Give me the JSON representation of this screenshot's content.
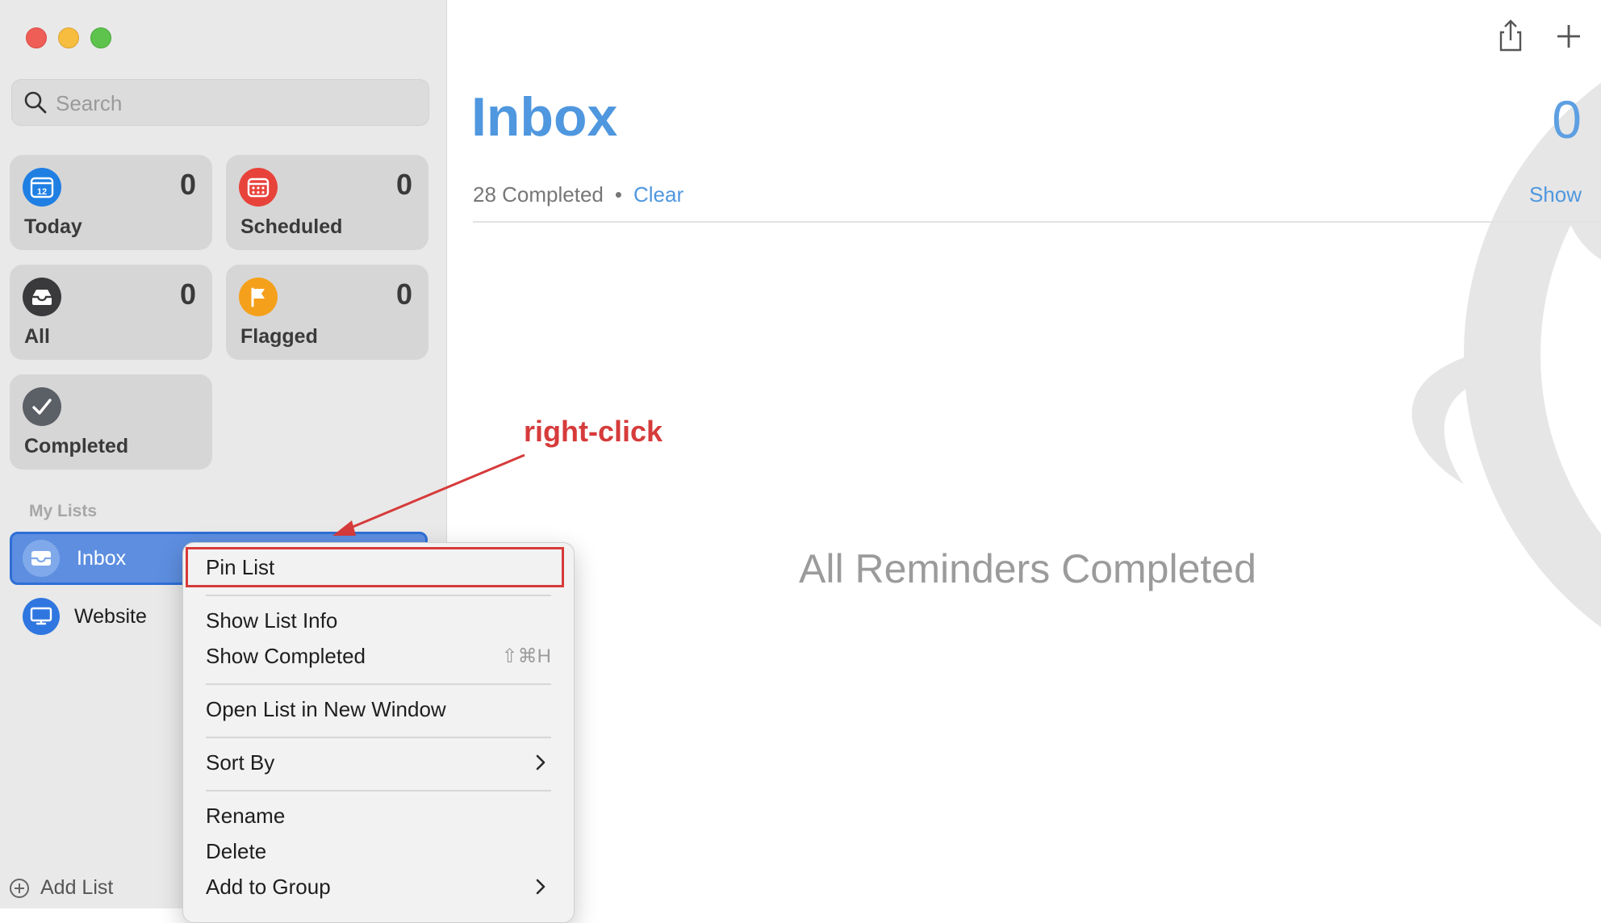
{
  "sidebar": {
    "search": {
      "placeholder": "Search",
      "icon": "search-icon"
    },
    "smart_lists": [
      {
        "label": "Today",
        "count": "0",
        "icon": "calendar-icon",
        "icon_text": "12",
        "color": "#1f7fe3"
      },
      {
        "label": "Scheduled",
        "count": "0",
        "icon": "calendar-grid-icon",
        "color": "#e8433a"
      },
      {
        "label": "All",
        "count": "0",
        "icon": "tray-icon",
        "color": "#3a3a3c"
      },
      {
        "label": "Flagged",
        "count": "0",
        "icon": "flag-icon",
        "color": "#f5a01b"
      },
      {
        "label": "Completed",
        "icon": "checkmark-icon",
        "color": "#5b5f66"
      }
    ],
    "section_label": "My Lists",
    "lists": [
      {
        "label": "Inbox",
        "icon": "inbox-tray-icon",
        "color": "#7fa9ea",
        "selected": true
      },
      {
        "label": "Website",
        "icon": "monitor-icon",
        "color": "#2f76e0"
      }
    ],
    "add_list_label": "Add List"
  },
  "main": {
    "title": "Inbox",
    "count": "0",
    "completed_text": "28 Completed",
    "separator": "•",
    "clear_label": "Clear",
    "show_label": "Show",
    "empty_message": "All Reminders Completed",
    "accent_color": "#4f97df"
  },
  "annotation": {
    "text": "right-click",
    "color": "#d63b3b"
  },
  "context_menu": {
    "items": [
      {
        "label": "Pin List",
        "highlighted": true
      },
      {
        "label": "Show List Info"
      },
      {
        "label": "Show Completed",
        "shortcut": "⇧⌘H"
      },
      {
        "label": "Open List in New Window"
      },
      {
        "label": "Sort By",
        "submenu": true
      },
      {
        "label": "Rename"
      },
      {
        "label": "Delete"
      },
      {
        "label": "Add to Group",
        "submenu": true
      }
    ]
  }
}
